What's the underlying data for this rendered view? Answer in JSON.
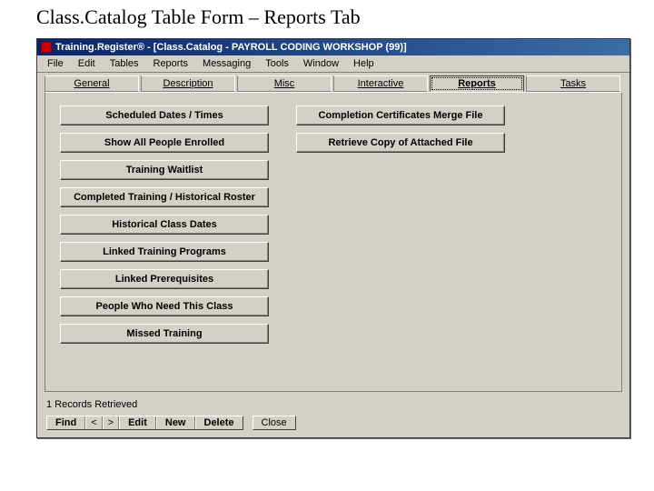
{
  "page_title": "Class.Catalog Table Form – Reports Tab",
  "titlebar": "Training.Register® - [Class.Catalog - PAYROLL CODING WORKSHOP (99)]",
  "menu": [
    "File",
    "Edit",
    "Tables",
    "Reports",
    "Messaging",
    "Tools",
    "Window",
    "Help"
  ],
  "tabs": {
    "general": "General",
    "description": "Description",
    "misc": "Misc",
    "interactive": "Interactive",
    "reports": "Reports",
    "tasks": "Tasks"
  },
  "col1_buttons": [
    "Scheduled Dates / Times",
    "Show All People Enrolled",
    "Training Waitlist",
    "Completed Training / Historical Roster",
    "Historical Class Dates",
    "Linked Training Programs",
    "Linked Prerequisites",
    "People Who Need This Class",
    "Missed Training"
  ],
  "col2_buttons": [
    "Completion Certificates Merge File",
    "Retrieve Copy of Attached File"
  ],
  "status": "1 Records Retrieved",
  "toolbar": {
    "find": "Find",
    "prev": "<",
    "next": ">",
    "edit": "Edit",
    "new": "New",
    "delete": "Delete",
    "close": "Close"
  }
}
